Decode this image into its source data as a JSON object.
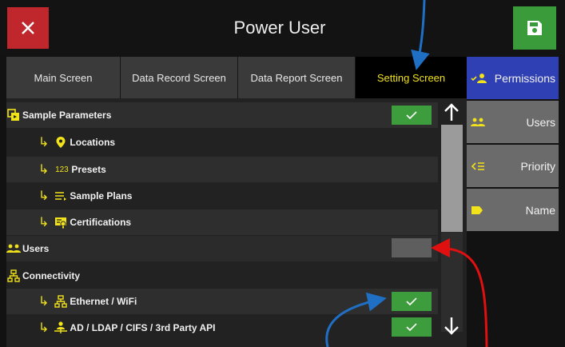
{
  "header": {
    "title": "Power User",
    "close_icon": "close-icon",
    "save_icon": "save-icon"
  },
  "tabs": [
    {
      "label": "Main Screen",
      "active": false
    },
    {
      "label": "Data Record Screen",
      "active": false
    },
    {
      "label": "Data Report Screen",
      "active": false
    },
    {
      "label": "Setting Screen",
      "active": true
    }
  ],
  "settings": {
    "sample_parameters": {
      "label": "Sample Parameters",
      "icon": "sample-parameters-icon",
      "enabled": true
    },
    "locations": {
      "label": "Locations",
      "icon": "location-pin-icon"
    },
    "presets": {
      "label": "Presets",
      "icon": "number-123-icon"
    },
    "sample_plans": {
      "label": "Sample Plans",
      "icon": "list-icon"
    },
    "certifications": {
      "label": "Certifications",
      "icon": "certificate-icon"
    },
    "users": {
      "label": "Users",
      "icon": "users-icon",
      "enabled": false
    },
    "connectivity": {
      "label": "Connectivity",
      "icon": "network-icon"
    },
    "ethernet_wifi": {
      "label": "Ethernet / WiFi",
      "icon": "network-icon",
      "enabled": true
    },
    "ad_ldap": {
      "label": "AD / LDAP / CIFS / 3rd Party API",
      "icon": "user-network-icon",
      "enabled": true
    }
  },
  "sidebar": [
    {
      "label": "Permissions",
      "icon": "permissions-icon",
      "active": true
    },
    {
      "label": "Users",
      "icon": "users-icon",
      "active": false
    },
    {
      "label": "Priority",
      "icon": "priority-icon",
      "active": false
    },
    {
      "label": "Name",
      "icon": "label-tag-icon",
      "active": false
    }
  ],
  "colors": {
    "accent_yellow": "#f1e21a",
    "check_green": "#3d9d3d",
    "close_red": "#c0272d",
    "active_blue": "#2f3fb4",
    "callout_blue": "#1f6fc4",
    "callout_red": "#e01010"
  }
}
